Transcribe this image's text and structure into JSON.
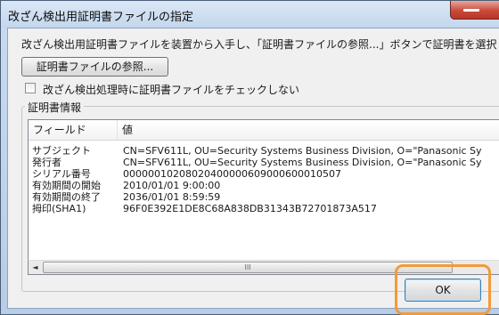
{
  "window": {
    "title": "改ざん検出用証明書ファイルの指定"
  },
  "dialog": {
    "instruction": "改ざん検出用証明書ファイルを装置から入手し、「証明書ファイルの参照...」ボタンで証明書を選択して",
    "browse_button": "証明書ファイルの参照...",
    "checkbox_label": "改ざん検出処理時に証明書ファイルをチェックしない",
    "checkbox_checked": false,
    "group_title": "証明書情報",
    "ok_button": "OK"
  },
  "cert_table": {
    "columns": [
      "フィールド",
      "値"
    ],
    "rows": [
      {
        "field": "サブジェクト",
        "value": "CN=SFV611L, OU=Security Systems Business Division, O=\"Panasonic Sy"
      },
      {
        "field": "発行者",
        "value": "CN=SFV611L, OU=Security Systems Business Division, O=\"Panasonic Sy"
      },
      {
        "field": "シリアル番号",
        "value": "00000010208020400000609000600010507"
      },
      {
        "field": "有効期間の開始",
        "value": "2010/01/01 9:00:00"
      },
      {
        "field": "有効期間の終了",
        "value": "2036/01/01 8:59:59"
      },
      {
        "field": "拇印(SHA1)",
        "value": "96F0E392E1DE8C68A838DB31343B72701873A517"
      }
    ]
  },
  "scrollbar": {
    "left_arrow": "◄",
    "thumb_grip": "III"
  },
  "colors": {
    "highlight": "#f39a3a",
    "title_bar": "#c4d7ee",
    "close_button": "#c94a3a"
  }
}
